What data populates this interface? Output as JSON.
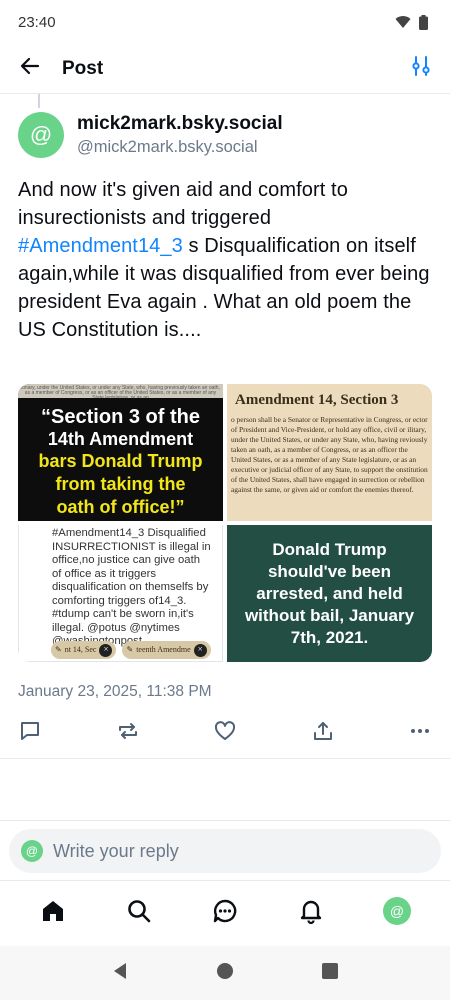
{
  "status": {
    "time": "23:40"
  },
  "header": {
    "title": "Post"
  },
  "author": {
    "display_name": "mick2mark.bsky.social",
    "handle": "@mick2mark.bsky.social",
    "avatar_glyph": "@"
  },
  "post": {
    "text_before": "And now it's given aid and comfort to insurectionists and triggered ",
    "hashtag": "#Amendment14_3",
    "text_after": " s Disqualification on itself again,while it was disqualified from ever being president Eva again . What an old poem the US Constitution is....",
    "timestamp": "January 23, 2025, 11:38 PM"
  },
  "images": {
    "img1": {
      "top_text": "ionary, under the United States, or under any State, who, having previously taken an oath, as a member of Congress, or as an officer of the United States, or as a member of any State legislature, or as an",
      "line1": "“Section 3 of the",
      "line2": "14th Amendment",
      "line3": "bars Donald Trump",
      "line4": "from taking the",
      "line5": "oath of office!”"
    },
    "img2": {
      "heading": "Amendment 14, Section 3",
      "body": "o person shall be a Senator or Representative in Congress, or ector of President and Vice-President, or hold any office, civil or ilitary, under the United States, or under any State, who, having reviously taken an oath, as a member of Congress, or as an officer the United States, or as a member of any State legislature, or as an executive or judicial officer of any State, to support the onstitution of the United States, shall have engaged in surrection or rebellion against the same, or given aid or comfort the enemies thereof."
    },
    "img3": {
      "text": "#Amendment14_3 Disqualified INSURRECTIONIST is illegal in office,no justice can give oath of office as it triggers disqualification on themselfs by comforting triggers of14_3. #tdump can't be sworn in,it's illegal. @potus @nytimes @washingtonpost",
      "chip1": "nt 14, Sec",
      "chip2": "teenth Amendme"
    },
    "img4": {
      "text": "Donald Trump should've been arrested, and held without bail, January 7th, 2021."
    }
  },
  "reply": {
    "placeholder": "Write your reply"
  },
  "colors": {
    "accent": "#1185fe",
    "avatar": "#6ad38a",
    "muted": "#6b7a8b"
  }
}
